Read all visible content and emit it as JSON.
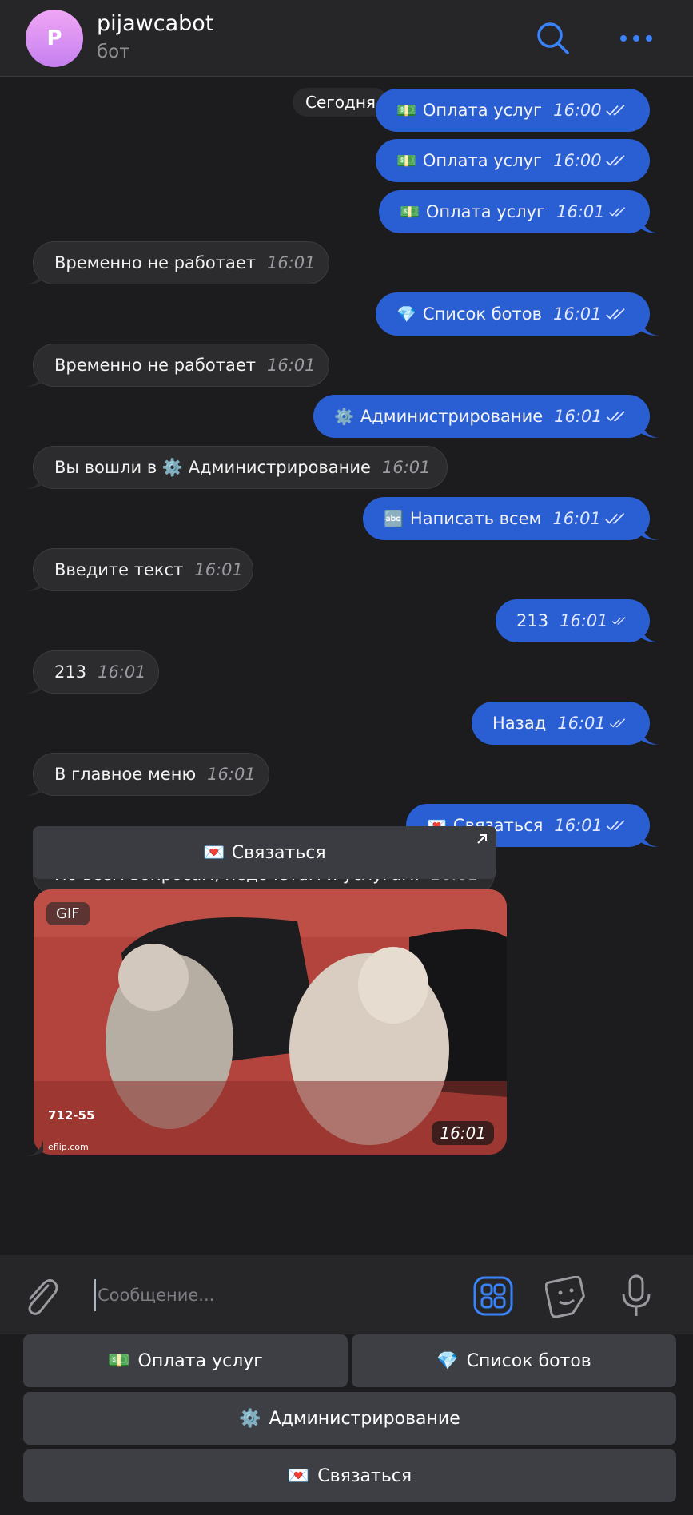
{
  "header": {
    "avatar_letter": "P",
    "title": "pijawcabot",
    "subtitle": "бот"
  },
  "date_separator": "Сегодня",
  "messages": [
    {
      "dir": "out",
      "emoji": "💵",
      "text": "Оплата услуг",
      "time": "16:00"
    },
    {
      "dir": "out",
      "emoji": "💵",
      "text": "Оплата услуг",
      "time": "16:00"
    },
    {
      "dir": "out",
      "emoji": "💵",
      "text": "Оплата услуг",
      "time": "16:01"
    },
    {
      "dir": "in",
      "text": "Временно не работает",
      "time": "16:01"
    },
    {
      "dir": "out",
      "emoji": "💎",
      "text": "Список ботов",
      "time": "16:01"
    },
    {
      "dir": "in",
      "text": "Временно не работает",
      "time": "16:01"
    },
    {
      "dir": "out",
      "emoji": "⚙️",
      "text": "Администрирование",
      "time": "16:01"
    },
    {
      "dir": "in",
      "text": "Вы вошли в ⚙️ Администрирование",
      "time": "16:01"
    },
    {
      "dir": "out",
      "emoji": "🔤",
      "text": "Написать всем",
      "time": "16:01"
    },
    {
      "dir": "in",
      "text": "Введите текст",
      "time": "16:01"
    },
    {
      "dir": "out",
      "text": "213",
      "time": "16:01"
    },
    {
      "dir": "in",
      "text": "213",
      "time": "16:01"
    },
    {
      "dir": "out",
      "text": "Назад",
      "time": "16:01"
    },
    {
      "dir": "in",
      "text": "В главное меню",
      "time": "16:01"
    },
    {
      "dir": "out",
      "emoji": "💌",
      "text": "Связаться",
      "time": "16:01"
    },
    {
      "dir": "in",
      "text": "По всем вопросам, недочетам и услугам.",
      "time": "16:01"
    }
  ],
  "inline_button": {
    "emoji": "💌",
    "label": "Связаться"
  },
  "gif": {
    "badge": "GIF",
    "time": "16:01"
  },
  "composer": {
    "placeholder": "Сообщение..."
  },
  "keyboard": [
    {
      "emoji": "💵",
      "label": "Оплата услуг"
    },
    {
      "emoji": "💎",
      "label": "Список ботов"
    },
    {
      "emoji": "⚙️",
      "label": "Администрирование"
    },
    {
      "emoji": "💌",
      "label": "Связаться"
    }
  ],
  "icons": {
    "search": "search-icon",
    "more": "more-icon",
    "attach": "paperclip-icon",
    "apps": "apps-icon",
    "sticker": "sticker-icon",
    "mic": "microphone-icon",
    "read": "double-check-icon"
  },
  "colors": {
    "outgoing": "#2a5fd4",
    "incoming": "#2c2c2e",
    "accent": "#3a82f7"
  }
}
